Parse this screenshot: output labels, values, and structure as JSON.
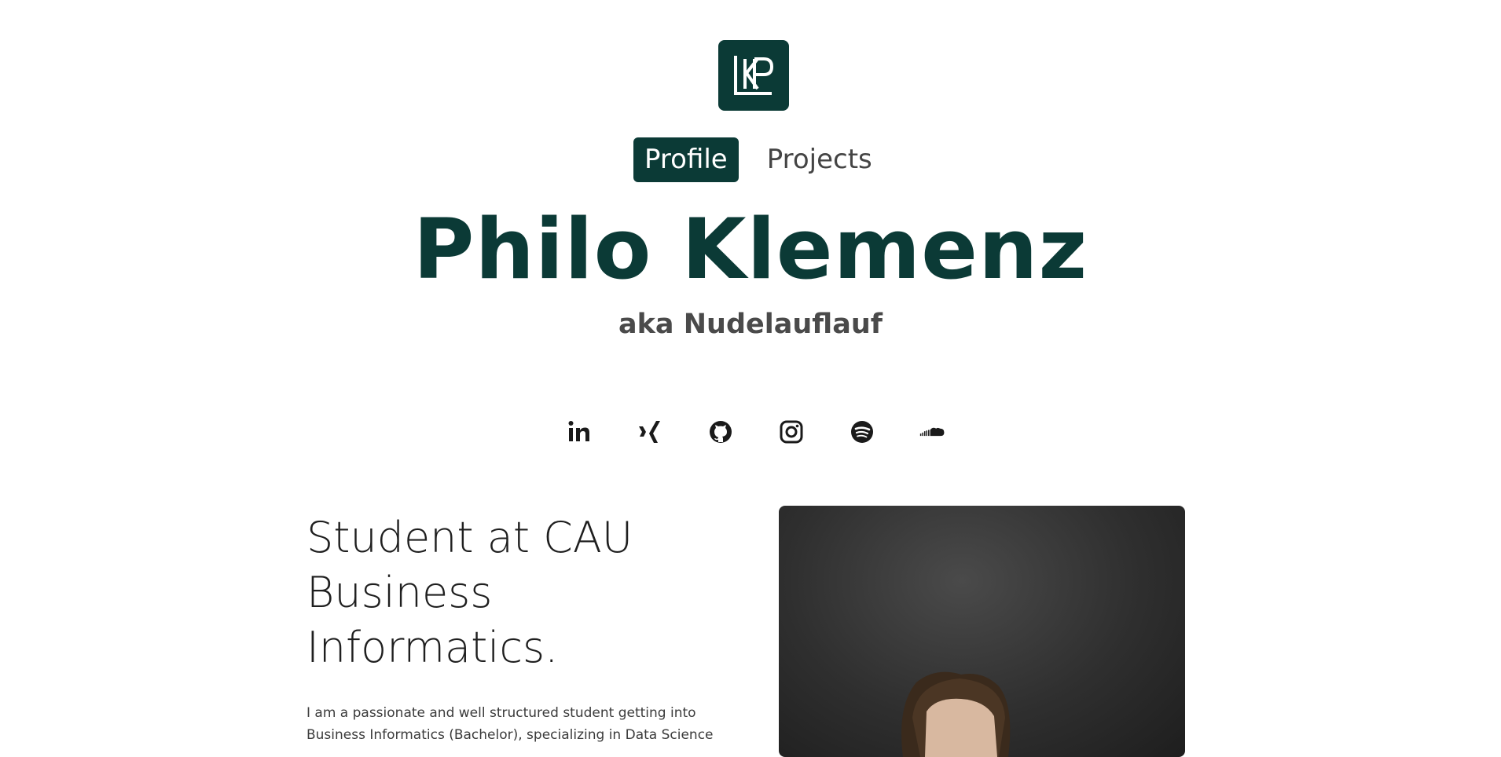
{
  "brand": {
    "logo_letters": "LKP",
    "color": "#0b3a36"
  },
  "nav": {
    "items": [
      {
        "label": "Profile",
        "active": true
      },
      {
        "label": "Projects",
        "active": false
      }
    ]
  },
  "hero": {
    "name": "Philo Klemenz",
    "subtitle": "aka Nudelauflauf"
  },
  "social": {
    "icons": [
      "linkedin-icon",
      "xing-icon",
      "github-icon",
      "instagram-icon",
      "spotify-icon",
      "soundcloud-icon"
    ]
  },
  "about": {
    "tagline": [
      "Student at CAU",
      "Business",
      "Informatics."
    ],
    "bio": [
      "I am a passionate and well structured student getting into",
      "Business Informatics (Bachelor), specializing in Data Science"
    ]
  },
  "colors": {
    "accent": "#0b3a36",
    "text": "#2a2a2a",
    "muted": "#4a4a4a"
  }
}
